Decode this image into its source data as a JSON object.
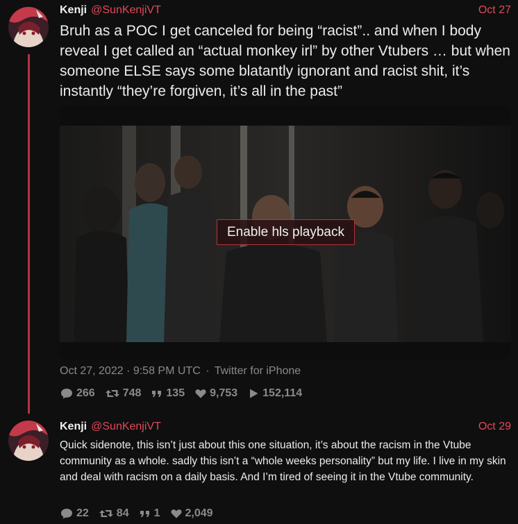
{
  "tweets": [
    {
      "display_name": "Kenji",
      "handle": "@SunKenjiVT",
      "date": "Oct 27",
      "text": "Bruh as a POC I get canceled for being “racist”.. and when I body reveal I get called an “actual monkey irl” by other Vtubers … but when someone ELSE says some blatantly ignorant and racist shit, it’s instantly “they’re forgiven, it’s all in the past”",
      "media": {
        "button_label": "Enable hls playback"
      },
      "meta": {
        "timestamp": "Oct 27, 2022 · 9:58 PM UTC",
        "separator": "·",
        "source": "Twitter for iPhone"
      },
      "stats": {
        "replies": "266",
        "retweets": "748",
        "quotes": "135",
        "likes": "9,753",
        "views": "152,114"
      }
    },
    {
      "display_name": "Kenji",
      "handle": "@SunKenjiVT",
      "date": "Oct 29",
      "text": "Quick sidenote, this isn’t just about this one situation, it’s about the racism in the Vtube community as a whole. sadly this isn’t a “whole weeks personality” but my life. I live in my skin and deal with racism on a daily basis. And I’m tired of seeing it in the Vtube community.",
      "stats": {
        "replies": "22",
        "retweets": "84",
        "quotes": "1",
        "likes": "2,049"
      }
    }
  ],
  "colors": {
    "background": "#0f0f0f",
    "accent": "#e2485a",
    "thread_line": "#b5323f",
    "muted": "#8a8a8a",
    "text": "#ececec"
  },
  "icons": {
    "reply": "comment-icon",
    "retweet": "retweet-icon",
    "quote": "quote-icon",
    "like": "heart-icon",
    "views": "play-icon"
  }
}
